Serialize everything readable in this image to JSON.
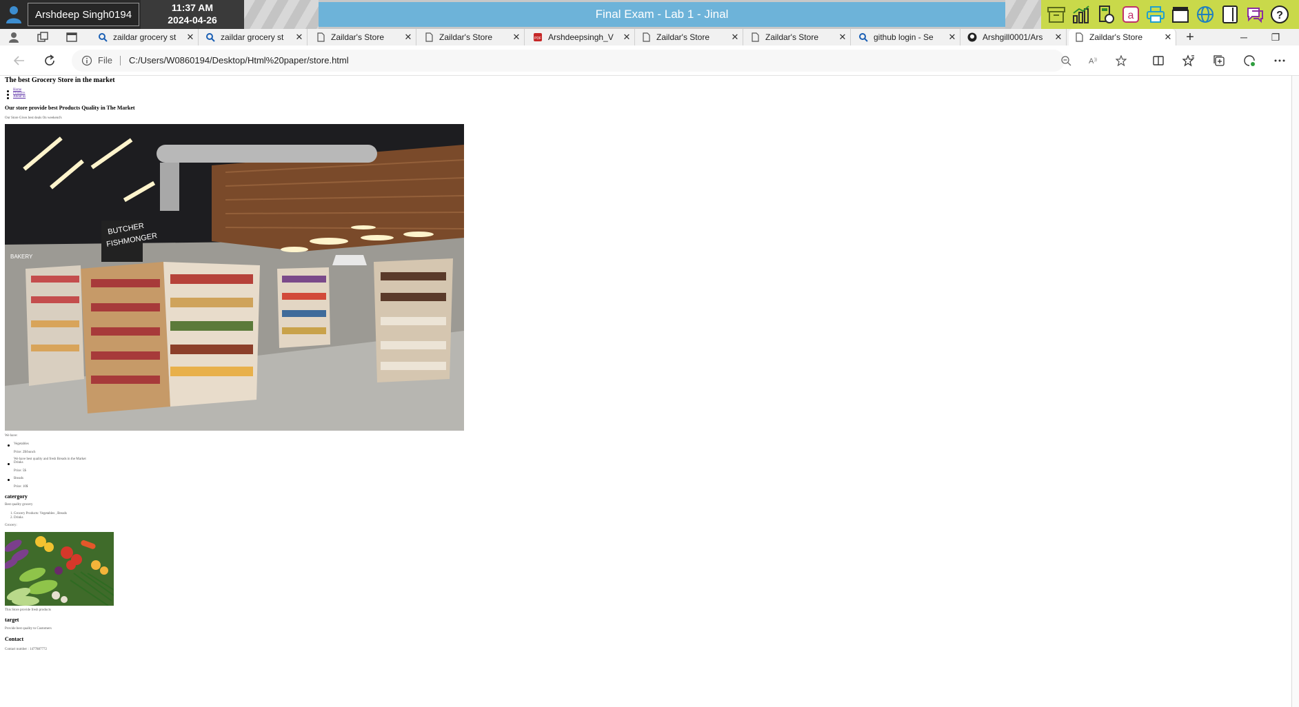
{
  "exam_bar": {
    "user_name": "Arshdeep Singh0194",
    "time": "11:37 AM",
    "date": "2024-04-26",
    "title": "Final Exam - Lab 1 - Jinal",
    "tools": [
      "archive-icon",
      "chart-icon",
      "calculator-icon",
      "dictionary-icon",
      "print-icon",
      "clapper-icon",
      "globe-icon",
      "tablet-icon",
      "chat-icon",
      "help-icon"
    ],
    "accent_color": "#6db3d9",
    "tools_color": "#c9d94a"
  },
  "browser": {
    "tabs": [
      {
        "label": "zaildar grocery st",
        "icon": "search-icon"
      },
      {
        "label": "zaildar grocery st",
        "icon": "search-icon"
      },
      {
        "label": "Zaildar's Store",
        "icon": "page-icon"
      },
      {
        "label": "Zaildar's Store",
        "icon": "page-icon"
      },
      {
        "label": "Arshdeepsingh_V",
        "icon": "pdf-icon"
      },
      {
        "label": "Zaildar's Store",
        "icon": "page-icon"
      },
      {
        "label": "Zaildar's Store",
        "icon": "page-icon"
      },
      {
        "label": "github login - Se",
        "icon": "search-icon"
      },
      {
        "label": "Arshgill0001/Ars",
        "icon": "github-icon"
      },
      {
        "label": "Zaildar's Store",
        "icon": "page-icon",
        "active": true
      }
    ],
    "new_tab": "+",
    "address": {
      "scheme": "File",
      "url": "C:/Users/W0860194/Desktop/Html%20paper/store.html"
    }
  },
  "page": {
    "heading": "The best Grocery Store in the market",
    "nav_links": [
      "Home",
      "Products",
      "About us"
    ],
    "subheading": "Our store provide best Products Quality in The Market",
    "intro": "Our Store Gives best deals On weekend's",
    "we_have": "We have:",
    "products": [
      {
        "name": "Vegetables",
        "price": "Price: 2$/bunch",
        "note": "We have best quality and fresh Breads in the Market"
      },
      {
        "name": "Drinks",
        "price": "Price: 5$",
        "note": ""
      },
      {
        "name": "Breads",
        "price": "Price: 10$",
        "note": ""
      }
    ],
    "category_heading": "catergory",
    "category_sub": "Best quality grocery",
    "category_items": [
      "1. Grocery Products: Vegetables , Breads",
      "2. Drinks"
    ],
    "grocery_label": "Grocery:",
    "veg_caption": "This Store provide fresh products",
    "target_heading": "target",
    "target_text": "Provide best quality to Customers",
    "contact_heading": "Contact",
    "contact_text": "Contact number : 1477887772"
  }
}
